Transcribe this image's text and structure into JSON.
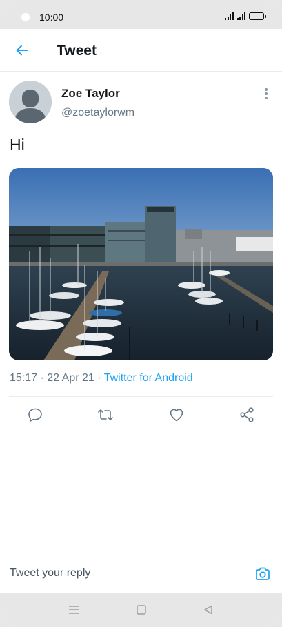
{
  "status_bar": {
    "time": "10:00"
  },
  "header": {
    "title": "Tweet",
    "back_icon": "arrow-left-icon"
  },
  "tweet": {
    "user_name": "Zoe Taylor",
    "user_handle": "@zoetaylorwm",
    "text": "Hi",
    "time": "15:17",
    "date": "22 Apr 21",
    "source": "Twitter for Android",
    "separator": "·",
    "photo_description": "marina-photo"
  },
  "actions": [
    {
      "name": "reply",
      "icon": "reply-icon"
    },
    {
      "name": "retweet",
      "icon": "retweet-icon"
    },
    {
      "name": "like",
      "icon": "heart-icon"
    },
    {
      "name": "share",
      "icon": "share-icon"
    }
  ],
  "reply": {
    "placeholder": "Tweet your reply",
    "camera_icon": "camera-icon"
  },
  "nav": [
    "menu",
    "home",
    "back"
  ],
  "colors": {
    "accent": "#1da1f2",
    "text": "#14171a",
    "secondary": "#657786",
    "icon": "#657786"
  }
}
